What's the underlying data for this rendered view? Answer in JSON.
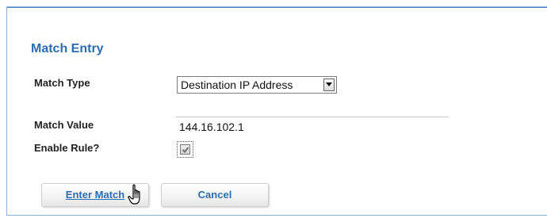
{
  "section": {
    "title": "Match Entry"
  },
  "fields": {
    "match_type": {
      "label": "Match Type",
      "value": "Destination IP Address"
    },
    "match_value": {
      "label": "Match Value",
      "value": "144.16.102.1"
    },
    "enable_rule": {
      "label": "Enable Rule?",
      "checked": true
    }
  },
  "buttons": {
    "enter_match": "Enter Match",
    "cancel": "Cancel"
  },
  "icons": {
    "dropdown": "chevron-down-icon",
    "checkbox": "checkmark-icon",
    "cursor": "hand-pointer-icon"
  },
  "colors": {
    "accent": "#2a6db0",
    "frame_border": "#8aaed6"
  }
}
